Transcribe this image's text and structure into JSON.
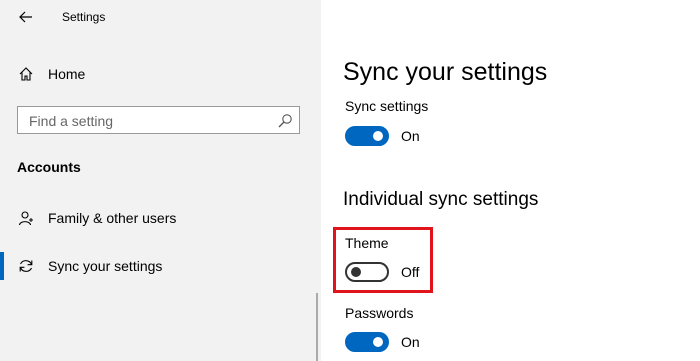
{
  "app": {
    "title": "Settings"
  },
  "sidebar": {
    "home_label": "Home",
    "search_placeholder": "Find a setting",
    "section_title": "Accounts",
    "items": [
      {
        "label": "Family & other users",
        "icon": "person-icon"
      },
      {
        "label": "Sync your settings",
        "icon": "sync-icon",
        "active": true
      }
    ]
  },
  "main": {
    "page_title": "Sync your settings",
    "sync_settings": {
      "label": "Sync settings",
      "state": "On"
    },
    "section_heading": "Individual sync settings",
    "theme": {
      "label": "Theme",
      "state": "Off"
    },
    "passwords": {
      "label": "Passwords",
      "state": "On"
    }
  },
  "colors": {
    "accent": "#0067c0",
    "highlight": "#e1141b",
    "sidebar_bg": "#f2f2f2"
  }
}
